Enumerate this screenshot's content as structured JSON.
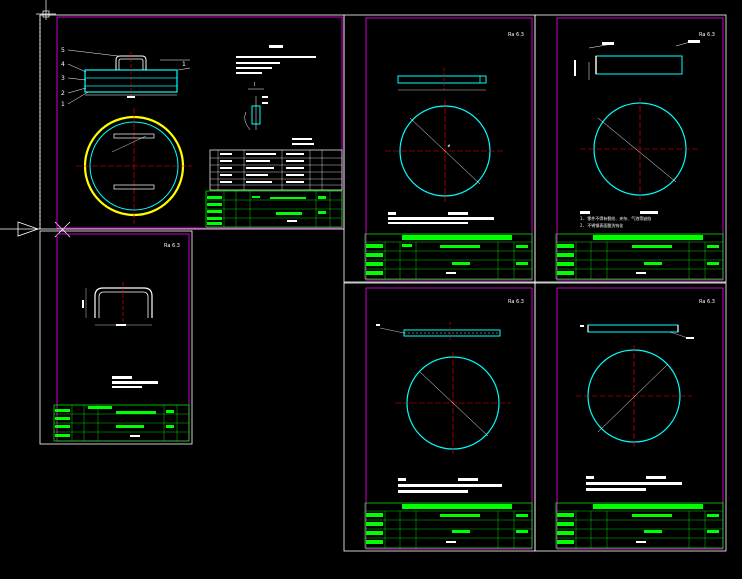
{
  "drawings": {
    "assembly": {
      "item_numbers": [
        "5",
        "4",
        "3",
        "2",
        "1"
      ],
      "item_number_right": "1",
      "section_mark": "I"
    },
    "roughness_symbol": "Ra 6.3",
    "notes": {
      "line1": "1. 零件不得有裂纹、夹杂、气泡等缺陷",
      "line2": "2. 不锈钢表面酸洗钝化"
    },
    "colors": {
      "background": "#000000",
      "frame": "#ff00ff",
      "outline": "#ffffff",
      "part": "#00ffff",
      "gasket": "#ffff00",
      "center_line": "#ff0000",
      "title_block": "#00ff00"
    }
  }
}
